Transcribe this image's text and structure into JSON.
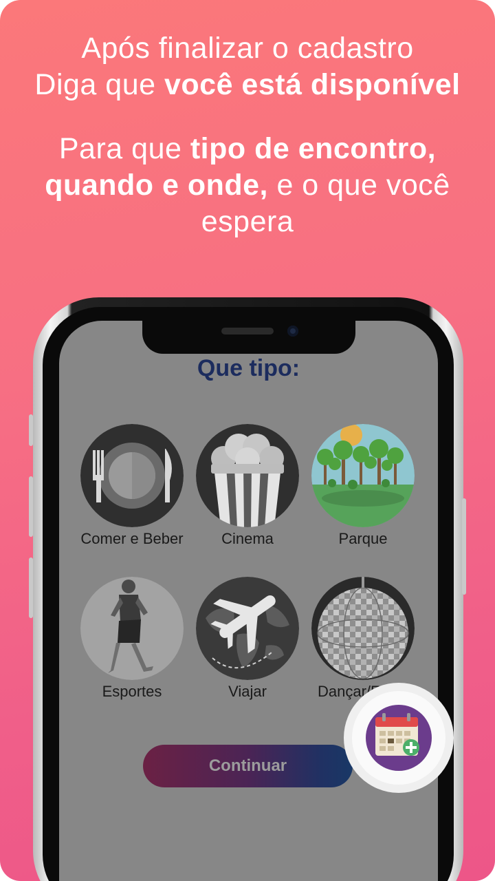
{
  "headline_1": {
    "line1": "Após finalizar o cadastro",
    "line2_normal": "Diga que ",
    "line2_bold": "você está disponível"
  },
  "headline_2": {
    "line1_normal": "Para que ",
    "line1_bold": "tipo de encontro,",
    "line2_bold": "quando e onde,",
    "line2_normal": " e o que você",
    "line3": "espera"
  },
  "screen": {
    "title": "Que tipo:",
    "options": [
      {
        "label": "Comer e Beber",
        "icon": "plate-cutlery-icon"
      },
      {
        "label": "Cinema",
        "icon": "popcorn-icon"
      },
      {
        "label": "Parque",
        "icon": "park-icon"
      },
      {
        "label": "Esportes",
        "icon": "runner-icon"
      },
      {
        "label": "Viajar",
        "icon": "airplane-globe-icon"
      },
      {
        "label": "Dançar/Festa",
        "icon": "disco-ball-icon"
      }
    ],
    "continue_label": "Continuar",
    "fab_icon": "calendar-add-icon"
  },
  "colors": {
    "background_top": "#fb787a",
    "background_bottom": "#ed5688",
    "title": "#1c2c5e",
    "fab": "#6b3c8c"
  }
}
